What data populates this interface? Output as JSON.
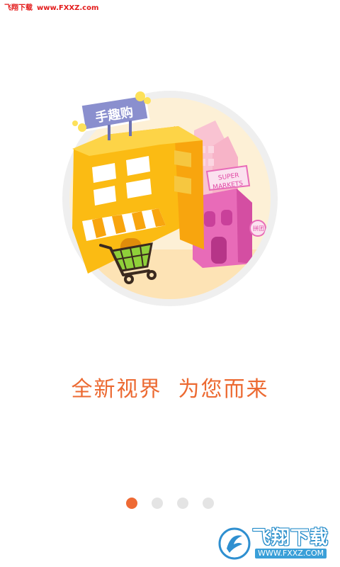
{
  "watermark_top": {
    "brand": "飞翔下载",
    "url": "www.FXXZ.com"
  },
  "illustration": {
    "sign_text": "手趣购",
    "supermarket_text_1": "SUPER",
    "supermarket_text_2": "MARKETS",
    "side_sign": "拼团"
  },
  "tagline": "全新视界  为您而来",
  "pager": {
    "count": 4,
    "active_index": 0
  },
  "watermark_bottom": {
    "brand": "飞翔下载",
    "url": "WWW.FXXZ.COM"
  },
  "colors": {
    "accent": "#ee6a34",
    "tagline": "#ec6a32",
    "dot_inactive": "#e4e4e4",
    "watermark_red": "#e31b1b"
  }
}
